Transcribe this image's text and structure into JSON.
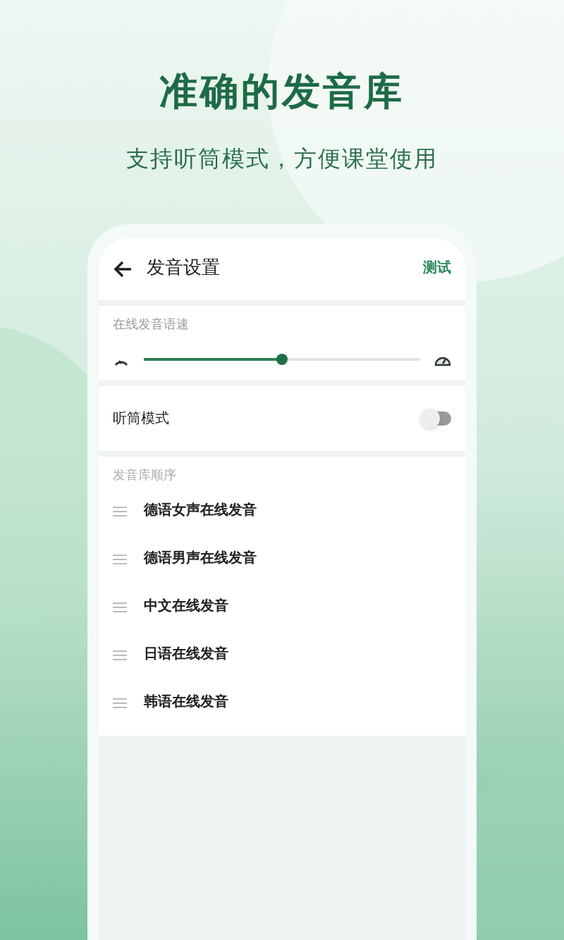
{
  "headline": "准确的发音库",
  "subheadline": "支持听筒模式，方便课堂使用",
  "screen": {
    "title": "发音设置",
    "action": "测试",
    "speed": {
      "label": "在线发音语速",
      "level": 0.5
    },
    "earpiece": {
      "label": "听筒模式",
      "on": false
    },
    "library": {
      "label": "发音库顺序",
      "items": [
        {
          "label": "德语女声在线发音"
        },
        {
          "label": "德语男声在线发音"
        },
        {
          "label": "中文在线发音"
        },
        {
          "label": "日语在线发音"
        },
        {
          "label": "韩语在线发音"
        }
      ]
    }
  }
}
